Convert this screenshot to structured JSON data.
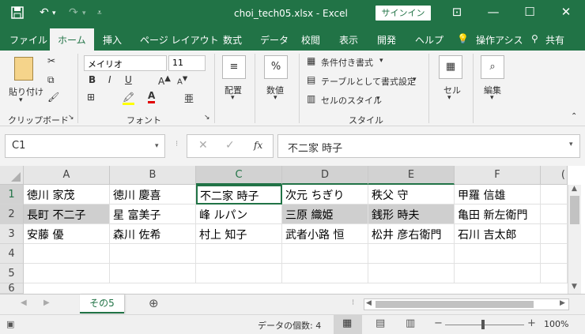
{
  "titlebar": {
    "title": "choi_tech05.xlsx  -  Excel",
    "signin": "サインイン",
    "save_icon": "save-icon",
    "undo_icon": "undo-icon",
    "redo_icon": "redo-icon"
  },
  "tabs": [
    "ファイル",
    "ホーム",
    "挿入",
    "ページ レイアウト",
    "数式",
    "データ",
    "校閲",
    "表示",
    "開発",
    "ヘルプ",
    "操作アシス",
    "共有"
  ],
  "ribbon": {
    "clipboard": {
      "paste": "貼り付け",
      "label": "クリップボード"
    },
    "font": {
      "name": "メイリオ",
      "size": "11",
      "label": "フォント",
      "bold": "B",
      "italic": "I",
      "underline": "U"
    },
    "alignment": {
      "label": "配置"
    },
    "number": {
      "label": "数値",
      "symbol": "%"
    },
    "styles": {
      "conditional": "条件付き書式",
      "table": "テーブルとして書式設定",
      "cellstyle": "セルのスタイル",
      "label": "スタイル"
    },
    "cells": {
      "label": "セル"
    },
    "editing": {
      "label": "編集"
    }
  },
  "formula": {
    "namebox": "C1",
    "fx": "fx",
    "value": "不二家 時子"
  },
  "columns": [
    "A",
    "B",
    "C",
    "D",
    "E",
    "F"
  ],
  "rows": [
    "1",
    "2",
    "3",
    "4",
    "5"
  ],
  "cells": {
    "r1": [
      "徳川 家茂",
      "徳川 慶喜",
      "不二家 時子",
      "次元 ちぎり",
      "秩父 守",
      "甲羅 信雄"
    ],
    "r2": [
      "長町 不二子",
      "星 富美子",
      "峰 ルパン",
      "三原 織姫",
      "銭形 時夫",
      "亀田 新左衛門"
    ],
    "r3": [
      "安藤 優",
      "森川 佐希",
      "村上 知子",
      "武者小路 恒",
      "松井 彦右衛門",
      "石川 吉太郎"
    ]
  },
  "sheet": {
    "tab": "その5"
  },
  "status": {
    "count": "データの個数: 4",
    "zoom": "100%"
  },
  "colors": {
    "accent": "#217346",
    "highlight": "#cfcfcf"
  }
}
